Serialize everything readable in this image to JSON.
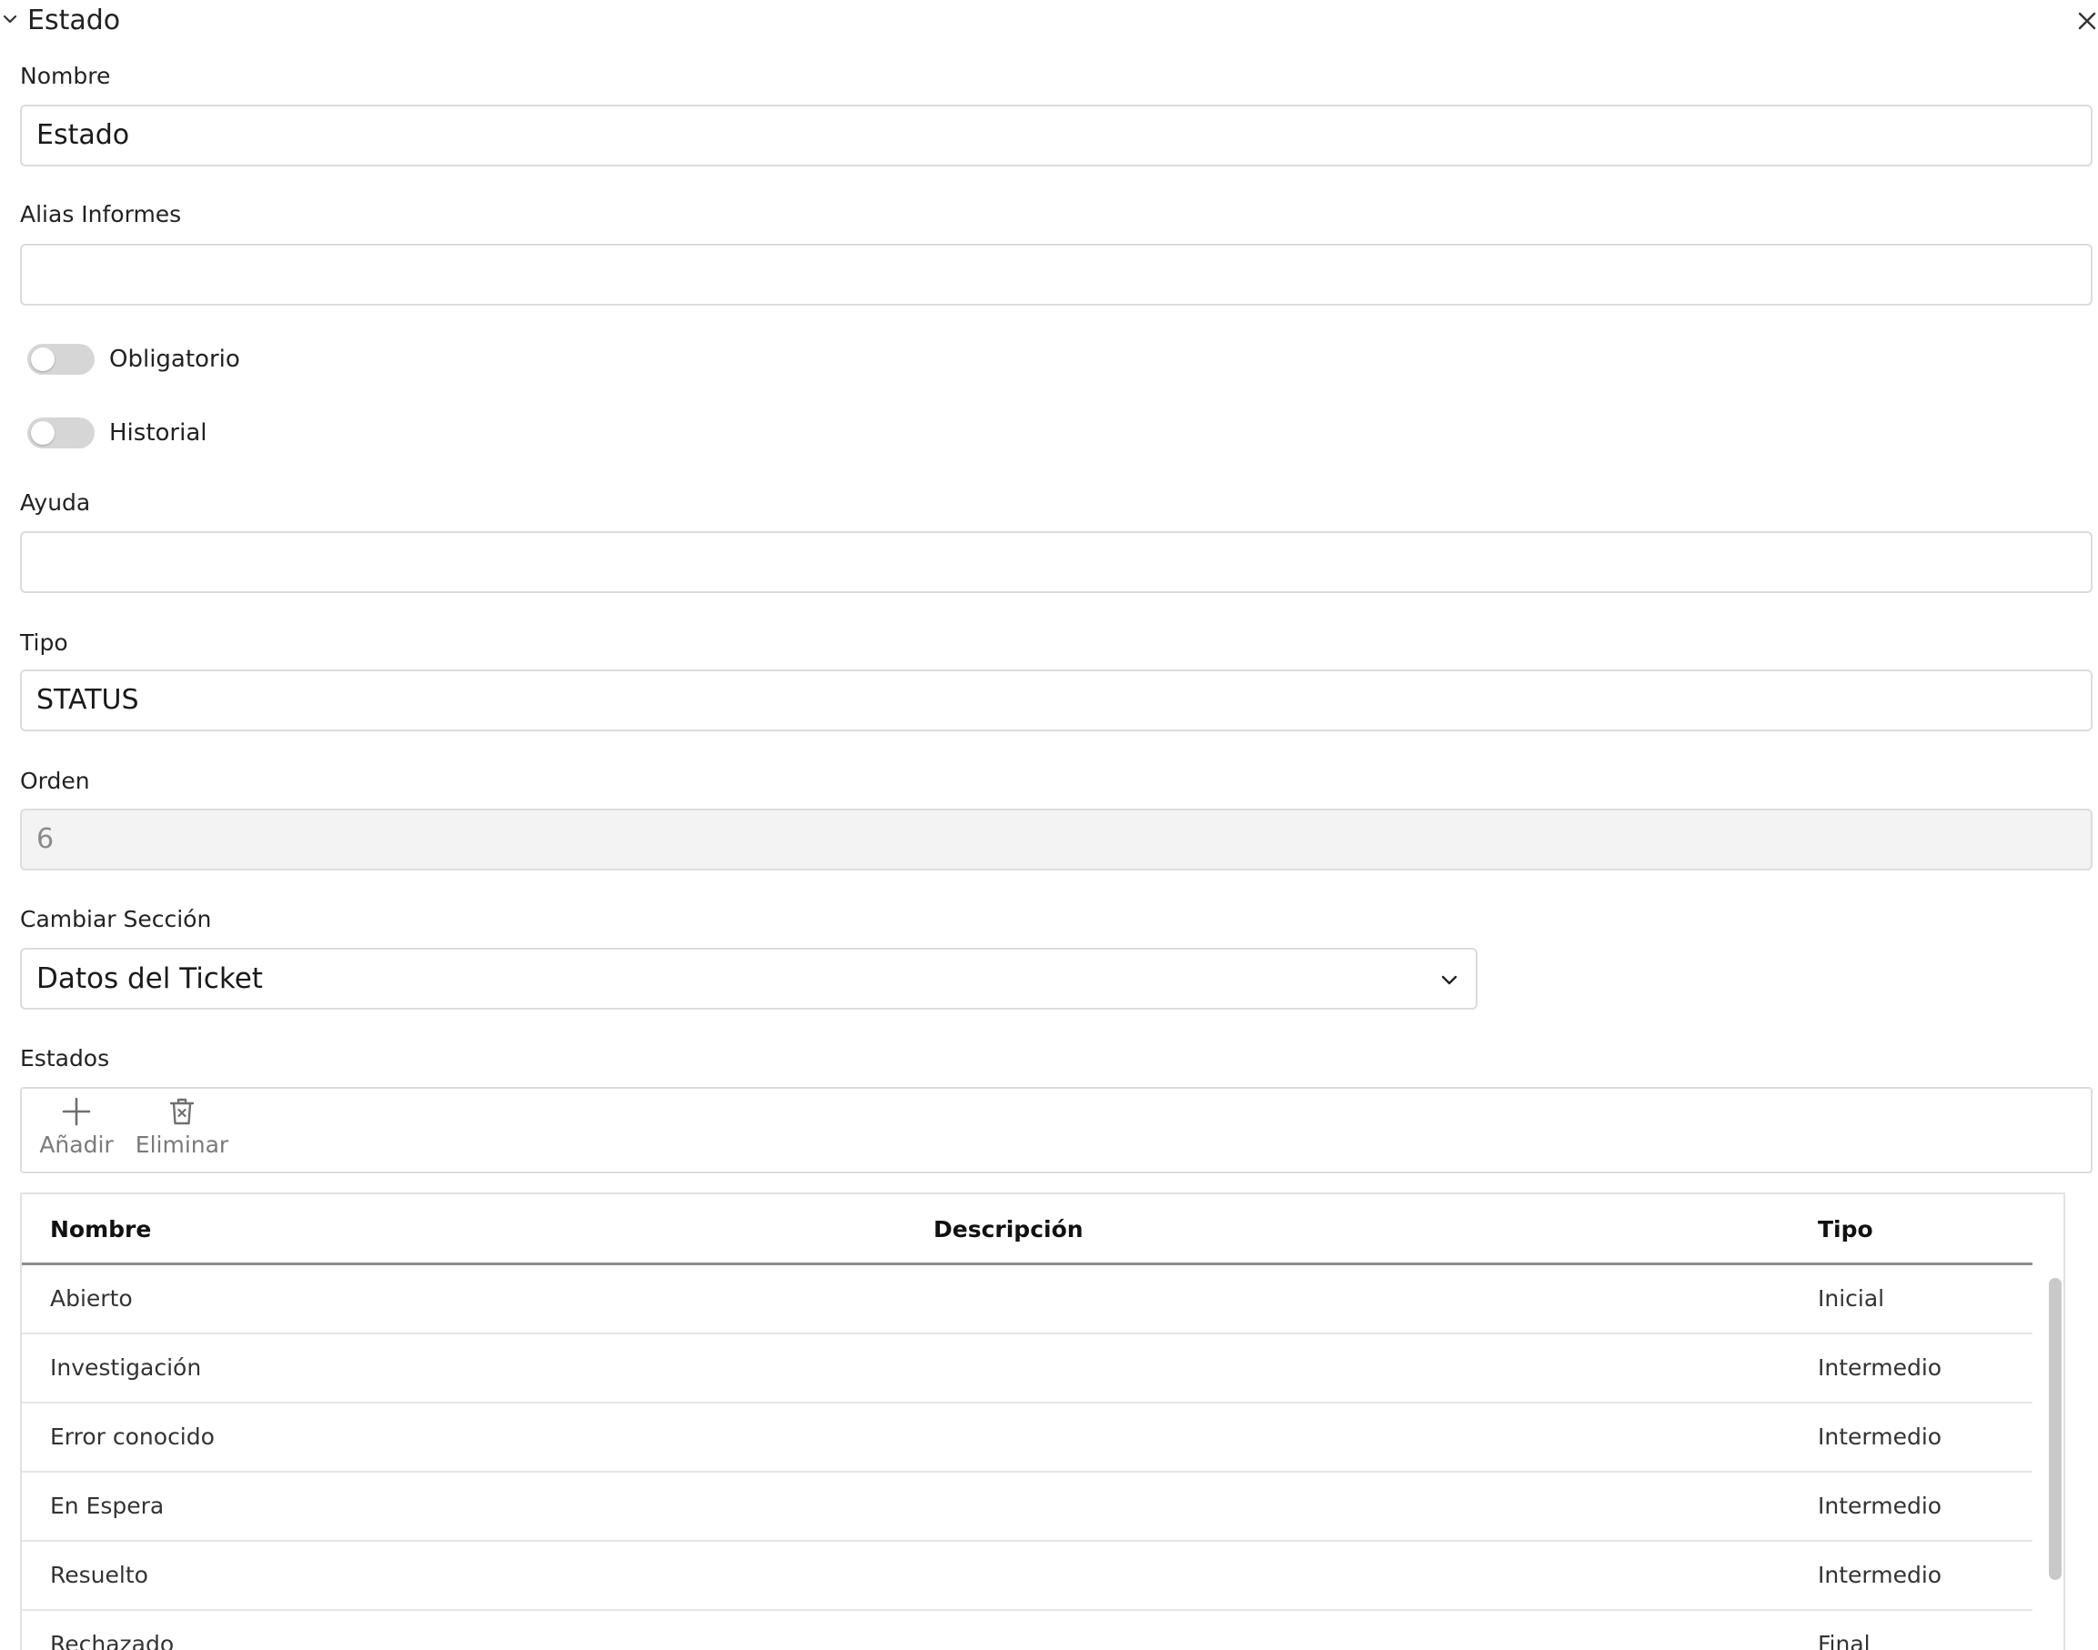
{
  "panel": {
    "title": "Estado"
  },
  "fields": {
    "nombre": {
      "label": "Nombre",
      "value": "Estado"
    },
    "alias": {
      "label": "Alias Informes",
      "value": ""
    },
    "obligatorio": {
      "label": "Obligatorio",
      "on": false
    },
    "historial": {
      "label": "Historial",
      "on": false
    },
    "ayuda": {
      "label": "Ayuda",
      "value": ""
    },
    "tipo": {
      "label": "Tipo",
      "value": "STATUS"
    },
    "orden": {
      "label": "Orden",
      "value": "6"
    },
    "seccion": {
      "label": "Cambiar Sección",
      "value": "Datos del Ticket"
    }
  },
  "estados": {
    "label": "Estados",
    "toolbar": {
      "add_label": "Añadir",
      "delete_label": "Eliminar"
    },
    "columns": {
      "nombre": "Nombre",
      "descripcion": "Descripción",
      "tipo": "Tipo"
    },
    "rows": [
      {
        "nombre": "Abierto",
        "descripcion": "",
        "tipo": "Inicial"
      },
      {
        "nombre": "Investigación",
        "descripcion": "",
        "tipo": "Intermedio"
      },
      {
        "nombre": "Error conocido",
        "descripcion": "",
        "tipo": "Intermedio"
      },
      {
        "nombre": "En Espera",
        "descripcion": "",
        "tipo": "Intermedio"
      },
      {
        "nombre": "Resuelto",
        "descripcion": "",
        "tipo": "Intermedio"
      },
      {
        "nombre": "Rechazado",
        "descripcion": "",
        "tipo": "Final"
      }
    ]
  },
  "icons": {
    "collapse": "chevron-down-icon",
    "close": "close-icon",
    "add": "plus-icon",
    "delete": "trash-icon",
    "select": "chevron-down-icon"
  }
}
